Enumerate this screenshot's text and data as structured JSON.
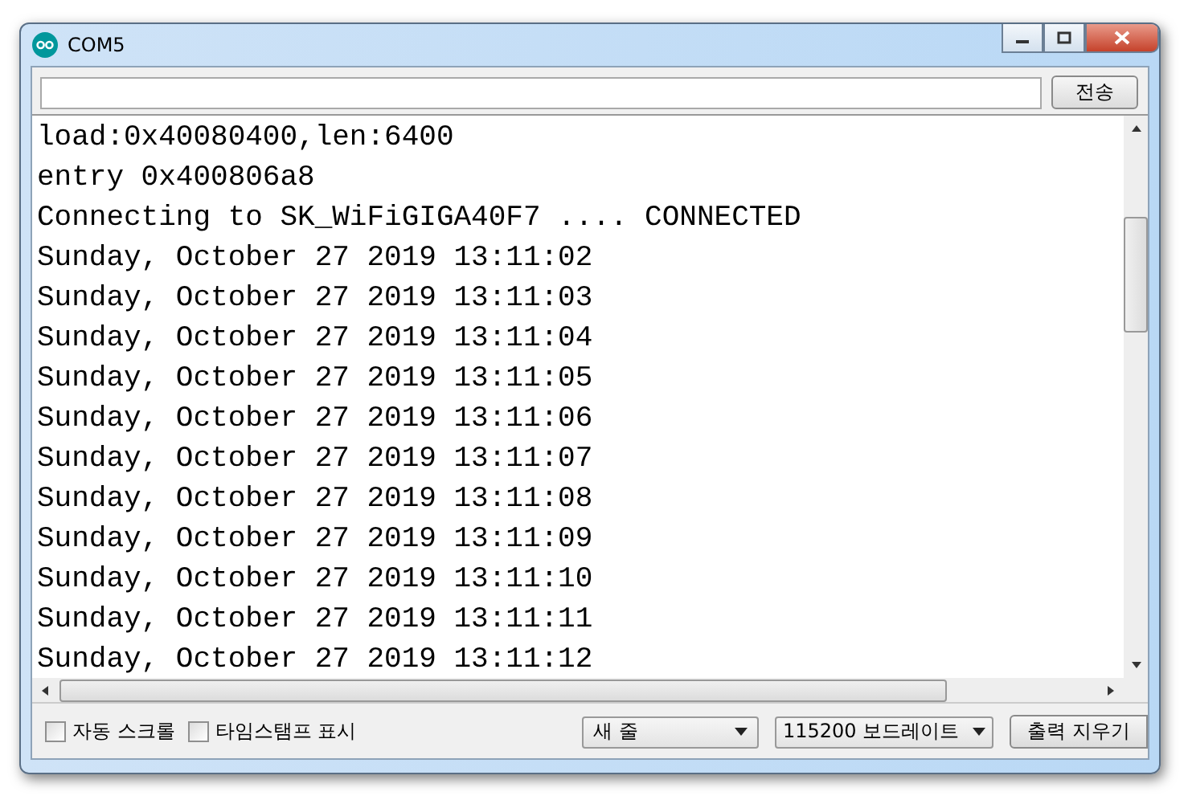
{
  "window": {
    "title": "COM5"
  },
  "send_button": "전송",
  "output_lines": [
    "load:0x40080400,len:6400",
    "entry 0x400806a8",
    "Connecting to SK_WiFiGIGA40F7 .... CONNECTED",
    "Sunday, October 27 2019 13:11:02",
    "Sunday, October 27 2019 13:11:03",
    "Sunday, October 27 2019 13:11:04",
    "Sunday, October 27 2019 13:11:05",
    "Sunday, October 27 2019 13:11:06",
    "Sunday, October 27 2019 13:11:07",
    "Sunday, October 27 2019 13:11:08",
    "Sunday, October 27 2019 13:11:09",
    "Sunday, October 27 2019 13:11:10",
    "Sunday, October 27 2019 13:11:11",
    "Sunday, October 27 2019 13:11:12"
  ],
  "options": [
    {
      "label": "자동 스크롤",
      "checked": false
    },
    {
      "label": "타임스탬프 표시",
      "checked": false
    }
  ],
  "line_ending": {
    "value": "새 줄"
  },
  "baud_rate": {
    "value": "115200 보드레이트"
  },
  "clear_button": "출력 지우기"
}
